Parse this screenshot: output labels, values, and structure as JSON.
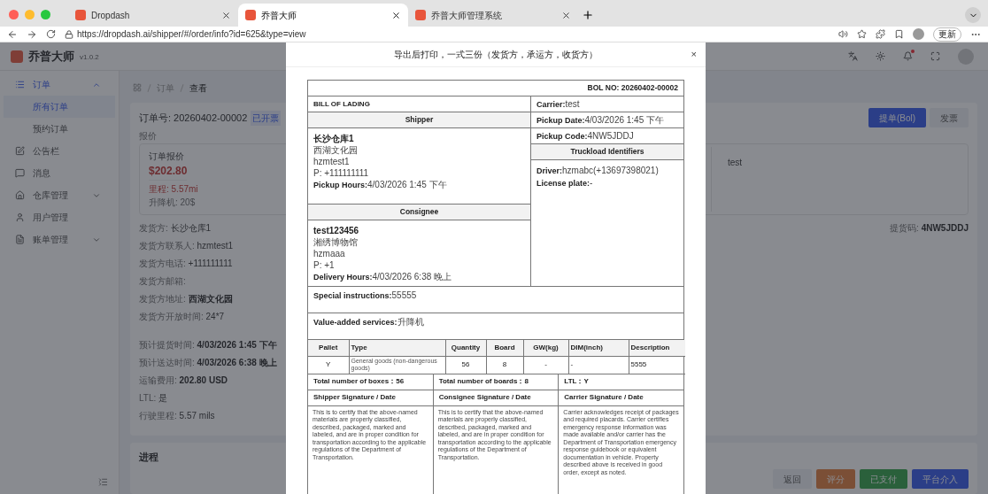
{
  "browser": {
    "tabs": [
      {
        "title": "Dropdash",
        "selected": false
      },
      {
        "title": "乔普大师",
        "selected": true
      },
      {
        "title": "乔普大师管理系统",
        "selected": false
      }
    ],
    "url": "https://dropdash.ai/shipper/#/order/info?id=625&type=view",
    "update_button": "更新"
  },
  "app": {
    "logo_text": "乔普大师",
    "version": "v1.0.2",
    "unread": true
  },
  "sidebar": {
    "items": [
      {
        "label": "订单",
        "selected": true,
        "expanded": true,
        "children": [
          {
            "label": "所有订单",
            "selected": true
          },
          {
            "label": "预约订单",
            "selected": false
          }
        ]
      },
      {
        "label": "公告栏",
        "selected": false
      },
      {
        "label": "消息",
        "selected": false
      },
      {
        "label": "仓库管理",
        "selected": false,
        "expanded": false
      },
      {
        "label": "用户管理",
        "selected": false
      },
      {
        "label": "账单管理",
        "selected": false,
        "expanded": false
      }
    ]
  },
  "breadcrumb": [
    "订单",
    "查看"
  ],
  "order": {
    "title": "订单号: 20260402-00002",
    "badge": "已开票",
    "actions": [
      {
        "label": "提单(Bol)",
        "kind": "primary"
      },
      {
        "label": "发票",
        "kind": "default"
      }
    ],
    "quote_label": "报价",
    "quote": {
      "title": "订单报价",
      "price": "$202.80",
      "mileage": "里程: 5.57mi",
      "lift": "升降机: 20$"
    },
    "side_note": "test",
    "shipper_fields": [
      {
        "label": "发货方: ",
        "value": "长沙仓库1",
        "bold": false
      },
      {
        "label": "发货方联系人: ",
        "value": "hzmtest1",
        "bold": false
      },
      {
        "label": "发货方电话: ",
        "value": "+111111111",
        "bold": false
      },
      {
        "label": "发货方邮箱:"
      },
      {
        "label": "发货方地址: ",
        "value": "西湖文化园",
        "bold": true
      },
      {
        "label": "发货方开放时间: ",
        "value": "24*7",
        "bold": false
      }
    ],
    "schedule_fields": [
      {
        "label": "预计提货时间: ",
        "value": "4/03/2026 1:45 下午",
        "bold": true
      },
      {
        "label": "预计送达时间: ",
        "value": "4/03/2026 6:38 晚上",
        "bold": true
      },
      {
        "label": "运输费用: ",
        "value": "202.80 USD",
        "bold": true
      },
      {
        "label": "LTL: ",
        "value": "是",
        "bold": false
      },
      {
        "label": "行驶里程: ",
        "value": "5.57 mils",
        "bold": false
      }
    ],
    "pickup_code": {
      "label": "提货码: ",
      "value": "4NW5JDDJ"
    }
  },
  "progress": {
    "title": "进程",
    "actions": [
      {
        "label": "返回",
        "kind": "default"
      },
      {
        "label": "评分",
        "kind": "warning"
      },
      {
        "label": "已支付",
        "kind": "success"
      },
      {
        "label": "平台介入",
        "kind": "primary"
      }
    ]
  },
  "modal": {
    "title": "导出后打印，一式三份（发货方，承运方，收货方）",
    "close": "×",
    "bol_no": "BOL NO: 20260402-00002",
    "doc_title": "BILL OF LADING",
    "shipper": {
      "heading": "Shipper",
      "name": "长沙仓库1",
      "lines": [
        "西湖文化园",
        "hzmtest1",
        "P: +111111111"
      ],
      "hours": {
        "label": "Pickup Hours:",
        "value": "4/03/2026 1:45 下午"
      }
    },
    "consignee": {
      "heading": "Consignee",
      "name": "test123456",
      "lines": [
        "湘绣博物馆",
        "hzmaaa",
        "P: +1"
      ],
      "hours": {
        "label": "Delivery Hours:",
        "value": "4/03/2026 6:38 晚上"
      }
    },
    "right_rows": [
      {
        "label": "Carrier:",
        "value": "test"
      },
      {
        "label": "Pickup Date:",
        "value": "4/03/2026 1:45 下午"
      },
      {
        "label": "Pickup Code:",
        "value": "4NW5JDDJ"
      }
    ],
    "truckload": {
      "heading": "Truckload Identifiers",
      "lines": [
        {
          "label": "Driver:",
          "value": "hzmabc(+13697398021)"
        },
        {
          "label": "License plate:",
          "value": "-"
        }
      ]
    },
    "notes": [
      {
        "label": "Special instructions:",
        "value": "55555"
      },
      {
        "label": "Value-added services:",
        "value": "升降机"
      }
    ],
    "items": {
      "columns": [
        "Pallet",
        "Type",
        "Quantity",
        "Board",
        "GW(kg)",
        "DIM(inch)",
        "Description"
      ],
      "rows": [
        [
          "Y",
          "General goods (non-dangerous goods)",
          "56",
          "8",
          "-",
          "-",
          "5555"
        ]
      ]
    },
    "totals": [
      {
        "label": "Total number of boxes：",
        "value": "56"
      },
      {
        "label": "Total number of boards：",
        "value": "8"
      },
      {
        "label": "LTL：",
        "value": "Y"
      }
    ],
    "signatures": [
      {
        "heading": "Shipper Signature / Date",
        "text": "This is to certify that the above-named materials are properly classified, described, packaged, marked and labeled, and are in proper condition for transportation according to the applicable regulations of the Department of Transportation."
      },
      {
        "heading": "Consignee Signature / Date",
        "text": "This is to certify that the above-named materials are properly classified, described, packaged, marked and labeled, and are in proper condition for transportation according to the applicable regulations of the Department of Transportation."
      },
      {
        "heading": "Carrier Signature / Date",
        "text": "Carrier acknowledges receipt of packages and required placards. Carrier certifies emergency response information was made available and/or carrier has the Department of Transportation emergency response guidebook or equivalent documentation in vehicle. Property described above is received in good order, except as noted."
      }
    ]
  }
}
